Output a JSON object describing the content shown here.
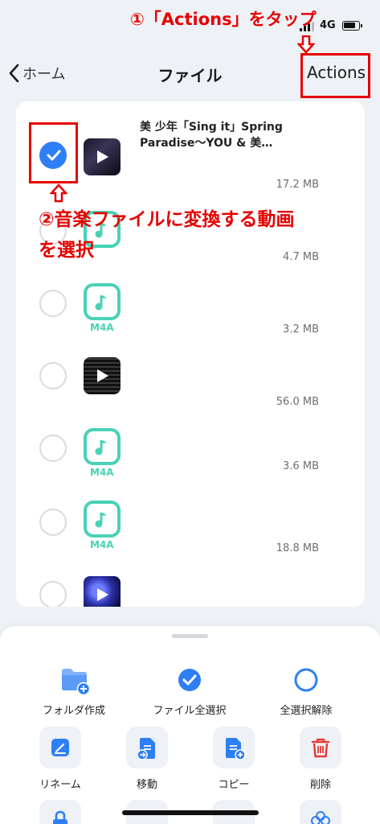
{
  "annotations": {
    "step1": "①「Actions」をタップ",
    "step2": "②音楽ファイルに変換する動画を選択"
  },
  "status_bar": {
    "network": "4G"
  },
  "nav": {
    "back_label": "ホーム",
    "title": "ファイル",
    "actions_label": "Actions"
  },
  "files": [
    {
      "kind": "video",
      "name": "美 少年「Sing it」Spring Paradise〜YOU & 美…",
      "size": "17.2 MB",
      "selected": true
    },
    {
      "kind": "audio",
      "name": "",
      "size": "4.7 MB",
      "selected": false
    },
    {
      "kind": "audio",
      "tag": "M4A",
      "name": "",
      "size": "3.2 MB",
      "selected": false
    },
    {
      "kind": "video",
      "name": "",
      "size": "56.0 MB",
      "selected": false
    },
    {
      "kind": "audio",
      "tag": "M4A",
      "name": "",
      "size": "3.6 MB",
      "selected": false
    },
    {
      "kind": "audio",
      "tag": "M4A",
      "name": "",
      "size": "18.8 MB",
      "selected": false
    },
    {
      "kind": "video",
      "name": "",
      "size": "",
      "selected": false
    }
  ],
  "sheet": {
    "quick_actions": [
      {
        "label": "フォルダ作成",
        "icon": "folder-add-icon"
      },
      {
        "label": "ファイル全選択",
        "icon": "check-circle-icon"
      },
      {
        "label": "全選択解除",
        "icon": "empty-circle-icon"
      }
    ],
    "tiles": [
      {
        "label": "リネーム",
        "icon": "rename-icon"
      },
      {
        "label": "移動",
        "icon": "move-icon"
      },
      {
        "label": "コピー",
        "icon": "copy-icon"
      },
      {
        "label": "削除",
        "icon": "trash-icon"
      }
    ]
  },
  "colors": {
    "accent": "#2f7ff4",
    "annotation": "#e60000",
    "audio": "#49d1b6",
    "delete": "#e53935"
  }
}
